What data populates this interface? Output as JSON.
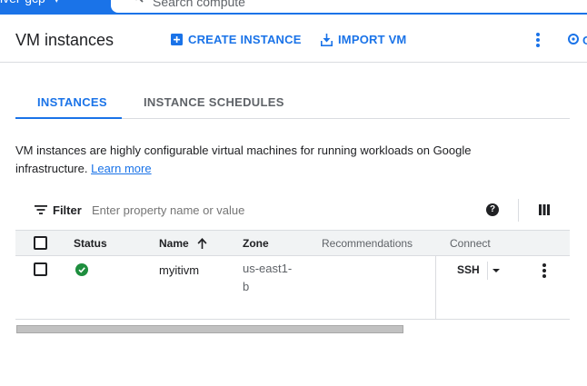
{
  "topbar": {
    "project": "iver-gcp",
    "search_placeholder": "Search  compute"
  },
  "header": {
    "title": "VM instances",
    "create_label": "CREATE INSTANCE",
    "import_label": "IMPORT VM",
    "edge_label": "O"
  },
  "tabs": [
    {
      "label": "INSTANCES",
      "active": true
    },
    {
      "label": "INSTANCE SCHEDULES",
      "active": false
    }
  ],
  "description": {
    "text": "VM instances are highly configurable virtual machines for running workloads on Google infrastructure.",
    "link": "Learn more"
  },
  "filter": {
    "label": "Filter",
    "placeholder": "Enter property name or value"
  },
  "table": {
    "columns": {
      "status": "Status",
      "name": "Name",
      "zone": "Zone",
      "recommendations": "Recommendations",
      "connect": "Connect"
    },
    "rows": [
      {
        "status": "running",
        "name": "myitivm",
        "zone": "us-east1-b",
        "recommendations": "",
        "connect": "SSH"
      }
    ]
  },
  "colors": {
    "accent": "#1a73e8",
    "status_ok": "#1e8e3e",
    "text": "#202124",
    "muted": "#5f6368"
  },
  "icons": {
    "create": "add-box-icon",
    "import": "download-icon",
    "filter": "filter-list-icon",
    "help": "help-circle-icon",
    "columns": "column-display-icon",
    "sort": "arrow-up-icon",
    "status": "check-circle-icon"
  }
}
